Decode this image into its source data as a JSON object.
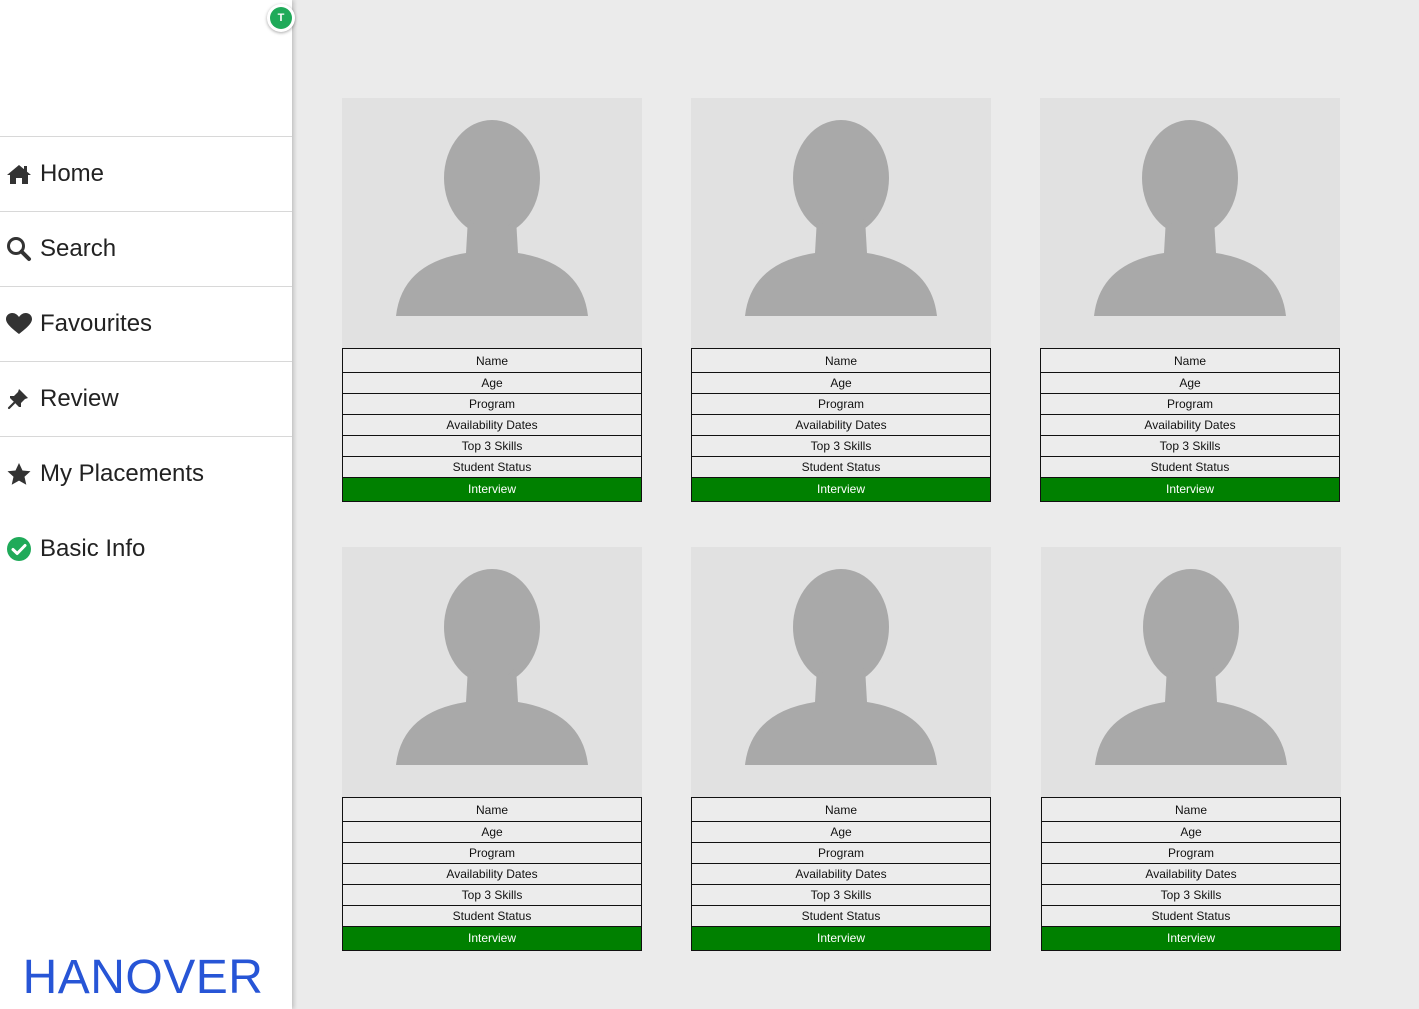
{
  "user": {
    "initial": "T"
  },
  "nav": [
    {
      "id": "home",
      "label": "Home",
      "icon": "home-icon"
    },
    {
      "id": "search",
      "label": "Search",
      "icon": "search-icon"
    },
    {
      "id": "favourites",
      "label": "Favourites",
      "icon": "heart-icon"
    },
    {
      "id": "review",
      "label": "Review",
      "icon": "pin-icon"
    },
    {
      "id": "my-placements",
      "label": "My Placements",
      "icon": "star-icon"
    },
    {
      "id": "basic-info",
      "label": "Basic Info",
      "icon": "check-circle-icon"
    }
  ],
  "brand": "HANOVER",
  "card_fields": [
    "Name",
    "Age",
    "Program",
    "Availability Dates",
    "Top 3 Skills",
    "Student Status"
  ],
  "interview_label": "Interview",
  "colors": {
    "interview": "#008000",
    "brand": "#2755d6",
    "avatar": "#1faa59"
  }
}
